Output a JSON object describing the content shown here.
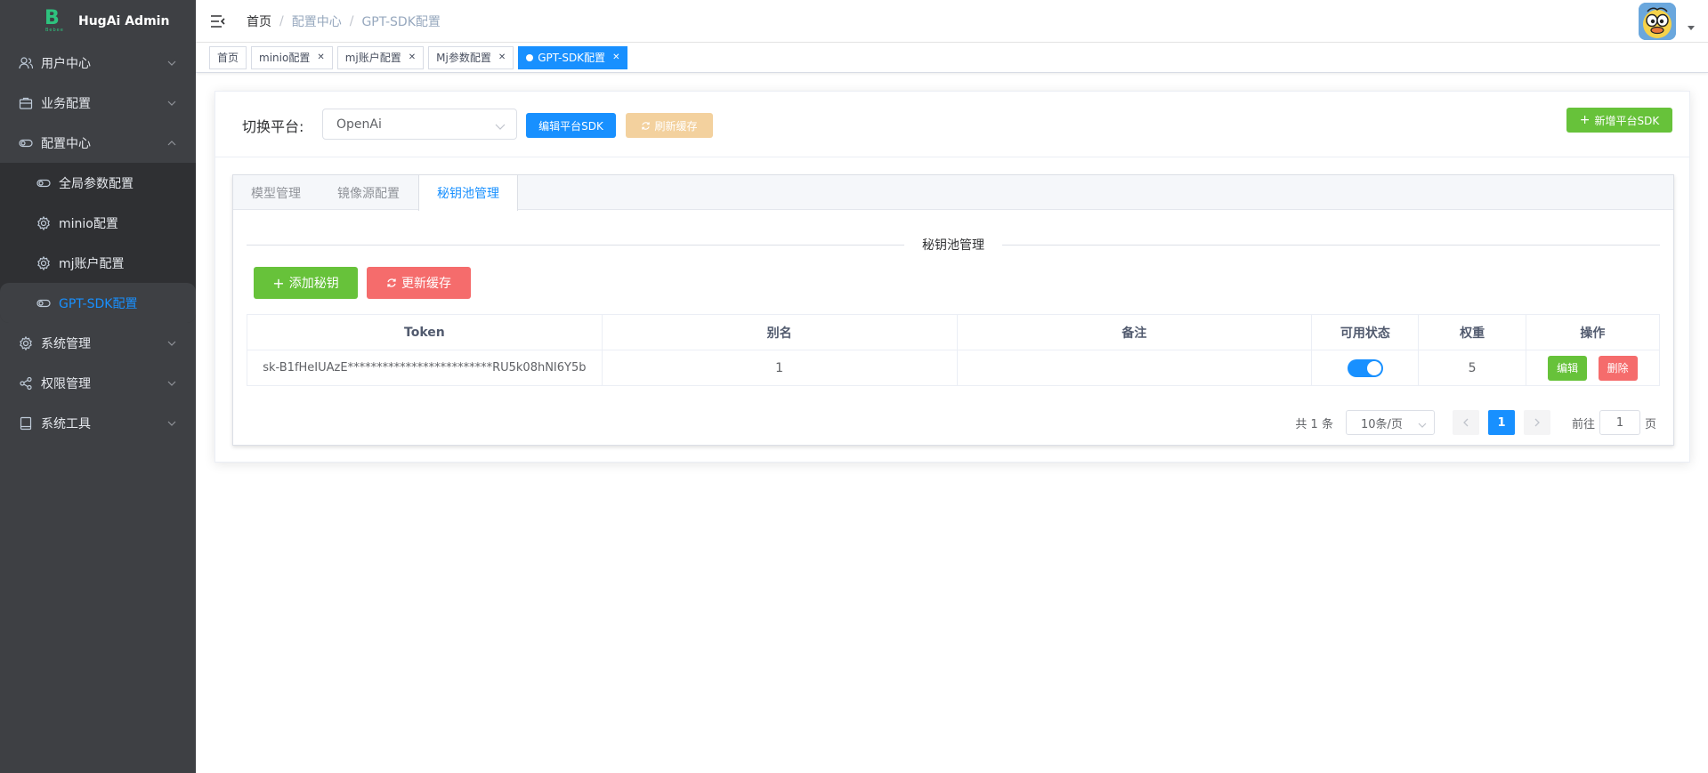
{
  "app": {
    "name": "HugAi Admin",
    "logo_letter": "B",
    "logo_sub": "Bebee"
  },
  "sidebar": {
    "items": [
      {
        "label": "用户中心",
        "icon": "user-icon"
      },
      {
        "label": "业务配置",
        "icon": "briefcase-icon"
      },
      {
        "label": "配置中心",
        "icon": "toggle-icon",
        "expanded": true
      },
      {
        "label": "系统管理",
        "icon": "gear-icon"
      },
      {
        "label": "权限管理",
        "icon": "share-icon"
      },
      {
        "label": "系统工具",
        "icon": "tool-icon"
      }
    ],
    "sub_items": [
      {
        "label": "全局参数配置",
        "icon": "toggle-icon"
      },
      {
        "label": "minio配置",
        "icon": "gear-icon"
      },
      {
        "label": "mj账户配置",
        "icon": "gear-icon"
      },
      {
        "label": "GPT-SDK配置",
        "icon": "toggle-icon",
        "active": true
      }
    ]
  },
  "header": {
    "breadcrumb": [
      "首页",
      "配置中心",
      "GPT-SDK配置"
    ],
    "separator": "/"
  },
  "tags": [
    {
      "label": "首页"
    },
    {
      "label": "minio配置",
      "closable": true
    },
    {
      "label": "mj账户配置",
      "closable": true
    },
    {
      "label": "Mj参数配置",
      "closable": true
    },
    {
      "label": "GPT-SDK配置",
      "closable": true,
      "active": true
    }
  ],
  "toolbar": {
    "switch_label": "切换平台:",
    "platform_value": "OpenAi",
    "edit_button": "编辑平台SDK",
    "refresh_button": "刷新缓存",
    "add_button": "新增平台SDK"
  },
  "tabs": [
    {
      "label": "模型管理"
    },
    {
      "label": "镜像源配置"
    },
    {
      "label": "秘钥池管理",
      "active": true
    }
  ],
  "section": {
    "title": "秘钥池管理",
    "add_key_button": "添加秘钥",
    "update_cache_button": "更新缓存"
  },
  "table": {
    "columns": [
      "Token",
      "别名",
      "备注",
      "可用状态",
      "权重",
      "操作"
    ],
    "rows": [
      {
        "token": "sk-B1fHeIUAzE*************************RU5k08hNI6Y5b",
        "alias": "1",
        "note": "",
        "enabled": true,
        "weight": "5",
        "edit": "编辑",
        "delete": "删除"
      }
    ]
  },
  "pagination": {
    "total": "共 1 条",
    "page_size": "10条/页",
    "current": "1",
    "goto_label": "前往",
    "goto_value": "1",
    "page_suffix": "页"
  },
  "colors": {
    "primary": "#1890ff",
    "success": "#67c23a",
    "danger": "#f56c6c",
    "sidebar": "#3e4044"
  }
}
